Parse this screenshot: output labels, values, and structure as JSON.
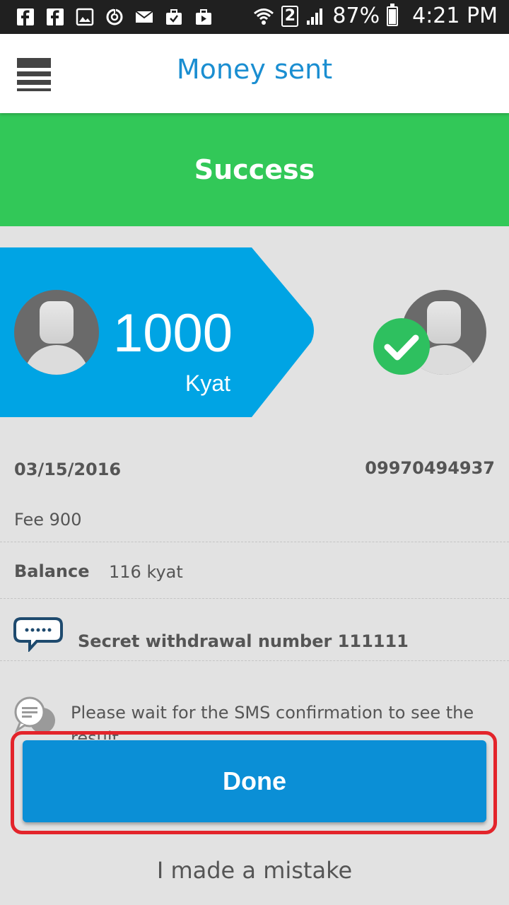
{
  "status_bar": {
    "battery": "87%",
    "sim_slot": "2",
    "time": "4:21 PM",
    "battery_level": 0.87,
    "notification_icons": [
      "facebook-icon",
      "facebook-icon",
      "image-icon",
      "sync-icon",
      "mail-icon",
      "briefcase-check-icon",
      "play-store-icon"
    ]
  },
  "app_bar": {
    "title": "Money sent",
    "menu_icon": "menu-icon"
  },
  "banner": {
    "text": "Success",
    "color": "#32c858"
  },
  "transfer": {
    "amount": "1000",
    "currency": "Kyat",
    "card_color": "#00a4e4",
    "status_icon": "check-circle-icon"
  },
  "details": {
    "date": "03/15/2016",
    "phone": "09970494937",
    "fee": "Fee 900",
    "balance_label": "Balance",
    "balance_value": "116 kyat",
    "secret_text": "Secret withdrawal number 111111",
    "sms_text": "Please wait for the SMS confirmation to see the result"
  },
  "actions": {
    "done_label": "Done",
    "mistake_label": "I made a mistake",
    "done_color": "#0b8fd6",
    "highlight_color": "#e3242b"
  }
}
